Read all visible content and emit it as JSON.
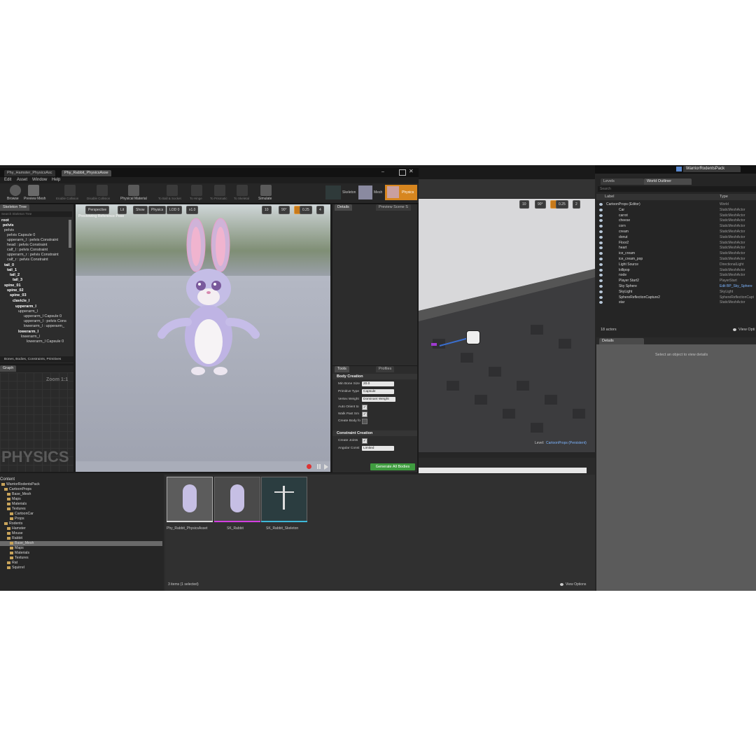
{
  "editor": {
    "tabs": [
      "Phy_Hamster_PhysicsAsc",
      "Phy_Rabbit_PhysicsAsse"
    ],
    "menu": [
      "Edit",
      "Asset",
      "Window",
      "Help"
    ],
    "toolbar": [
      "Browse",
      "Preview Mesh",
      "Enable Collision",
      "Disable Collision",
      "Physical Material",
      "To Ball & Socket",
      "To Hinge",
      "To Prismatic",
      "To Skeletal",
      "Simulate"
    ],
    "modes": [
      "Skeleton",
      "Mesh",
      "Physics"
    ]
  },
  "skeleton_tree": {
    "tab": "Skeleton Tree",
    "search_placeholder": "Search Skeleton Tree",
    "items": [
      "root",
      "pelvis",
      "pelvis",
      "pelvis Capsule 0",
      "upperarm_l : pelvis Constraint",
      "head : pelvis Constraint",
      "calf_l : pelvis Constraint",
      "upperarm_r : pelvis Constraint",
      "calf_r : pelvis Constraint",
      "tail_0",
      "tail_1",
      "tail_2",
      "tail_3",
      "spine_01",
      "spine_02",
      "spine_03",
      "clavicle_l",
      "upperarm_l",
      "upperarm_l",
      "upperarm_l Capsule 0",
      "upperarm_l : pelvis Cons",
      "lowerarm_l : upperarm_",
      "lowerarm_l",
      "lowerarm_l",
      "lowerarm_l Capsule 0"
    ],
    "filter": "Bones, Bodies, Constraints, Primitives"
  },
  "graph": {
    "tab": "Graph",
    "zoom": "Zoom 1:1",
    "watermark": "PHYSICS"
  },
  "viewport": {
    "buttons": [
      "Perspective",
      "Lit",
      "Show",
      "Physics",
      "LOD 0",
      "x1.0"
    ],
    "snap_values": [
      "10",
      "90°",
      "0.25",
      "4"
    ],
    "preview_label": "Previewing Reference Pose"
  },
  "details": {
    "tabs": [
      "Details",
      "Preview Scene S"
    ]
  },
  "tools": {
    "tabs": [
      "Tools",
      "Profiles"
    ],
    "body_creation": "Body Creation",
    "min_bone_size_label": "Min Bone Size",
    "min_bone_size": "20.0",
    "primitive_type_label": "Primitive Type",
    "primitive_type": "Capsule",
    "vertex_weight_label": "Vertex Weight",
    "vertex_weight": "Dominant Weight",
    "auto_orient_label": "Auto Orient to",
    "walk_past_label": "Walk Past Sm",
    "create_body_label": "Create Body fo",
    "constraint_creation": "Constraint Creation",
    "create_joints_label": "Create Joints",
    "angular_label": "Angular Const",
    "angular_value": "Limited",
    "generate": "Generate All Bodies"
  },
  "main": {
    "title": "WarriorRodentsPack",
    "level_prefix": "Level:",
    "level_name": "CartoonProps (Persistent)",
    "snap_values": [
      "10",
      "90°",
      "0.25",
      "2"
    ]
  },
  "outliner": {
    "tabs": [
      "Levels",
      "World Outliner"
    ],
    "search_placeholder": "Search",
    "col_label": "Label",
    "col_type": "Type",
    "rows": [
      {
        "label": "CartoonProps (Editor)",
        "type": "World"
      },
      {
        "label": "Car",
        "type": "StaticMeshActor"
      },
      {
        "label": "carrot",
        "type": "StaticMeshActor"
      },
      {
        "label": "cheese",
        "type": "StaticMeshActor"
      },
      {
        "label": "corn",
        "type": "StaticMeshActor"
      },
      {
        "label": "cream",
        "type": "StaticMeshActor"
      },
      {
        "label": "donut",
        "type": "StaticMeshActor"
      },
      {
        "label": "Floor2",
        "type": "StaticMeshActor"
      },
      {
        "label": "heart",
        "type": "StaticMeshActor"
      },
      {
        "label": "ice_cream",
        "type": "StaticMeshActor"
      },
      {
        "label": "ice_cream_pop",
        "type": "StaticMeshActor"
      },
      {
        "label": "Light Source",
        "type": "DirectionalLight"
      },
      {
        "label": "lollipop",
        "type": "StaticMeshActor"
      },
      {
        "label": "node",
        "type": "StaticMeshActor"
      },
      {
        "label": "Player Start2",
        "type": "PlayerStart"
      },
      {
        "label": "Sky Sphere",
        "type": "Edit BP_Sky_Sphere"
      },
      {
        "label": "SkyLight",
        "type": "SkyLight"
      },
      {
        "label": "SphereReflectionCapture2",
        "type": "SphereReflectionCapt"
      },
      {
        "label": "star",
        "type": "StaticMeshActor"
      }
    ],
    "count": "18 actors",
    "view_options": "View Opti"
  },
  "right_details": {
    "tab": "Details",
    "empty": "Select an object to view details"
  },
  "content": {
    "title": "Content",
    "tree": [
      "WarriorRodentsPack",
      "CartoonProps",
      "Base_Mesh",
      "Maps",
      "Materials",
      "Textures",
      "CartoonCar",
      "Props",
      "Rodents",
      "Hamster",
      "Mouse",
      "Rabbit",
      "Base_Mesh",
      "Maps",
      "Materials",
      "Textures",
      "Rat",
      "Squirrel"
    ],
    "assets": [
      {
        "name": "Phy_Rabbit_PhysicsAsset",
        "accent": "#d8d8d8"
      },
      {
        "name": "SK_Rabbit",
        "accent": "#d23fe0"
      },
      {
        "name": "SK_Rabbit_Skeleton",
        "accent": "#3fb8d8"
      }
    ],
    "status": "3 items (1 selected)",
    "view_options": "View Options"
  }
}
